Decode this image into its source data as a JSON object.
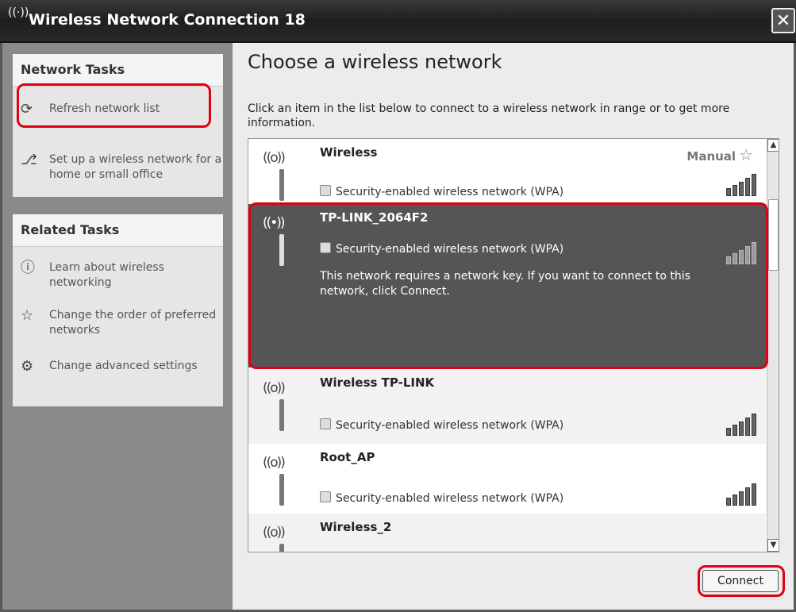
{
  "window": {
    "title": "Wireless Network Connection 18",
    "title_icon": "wireless-icon",
    "close": "✕"
  },
  "network_tasks": {
    "heading": "Network Tasks",
    "items": [
      {
        "label": "Refresh network list",
        "icon": "refresh-icon"
      },
      {
        "label": "Set up a wireless network for a home or small office",
        "icon": "wizard-icon"
      }
    ]
  },
  "related_tasks": {
    "heading": "Related Tasks",
    "items": [
      {
        "label": "Learn about wireless networking",
        "icon": "info-icon"
      },
      {
        "label": "Change the order of preferred networks",
        "icon": "star-icon"
      },
      {
        "label": "Change advanced settings",
        "icon": "settings-icon"
      }
    ]
  },
  "main": {
    "heading": "Choose a wireless network",
    "intro": "Click an item in the list below to connect to a wireless network in range or to get more information.",
    "networks": [
      {
        "name": "Wireless",
        "security": "Security-enabled wireless network (WPA)",
        "badge": "Manual",
        "signal": 4
      },
      {
        "name": "TP-LINK_2064F2",
        "security": "Security-enabled wireless network (WPA)",
        "message": "This network requires a network key. If you want to connect to this network, click Connect.",
        "selected": true,
        "signal": 4
      },
      {
        "name": "Wireless TP-LINK",
        "security": "Security-enabled wireless network (WPA)",
        "signal": 4
      },
      {
        "name": "Root_AP",
        "security": "Security-enabled wireless network (WPA)",
        "signal": 4
      },
      {
        "name": "Wireless_2",
        "signal": 3
      }
    ],
    "connect_label": "Connect"
  },
  "colors": {
    "highlight": "#e00012",
    "selected_bg": "#555555"
  }
}
